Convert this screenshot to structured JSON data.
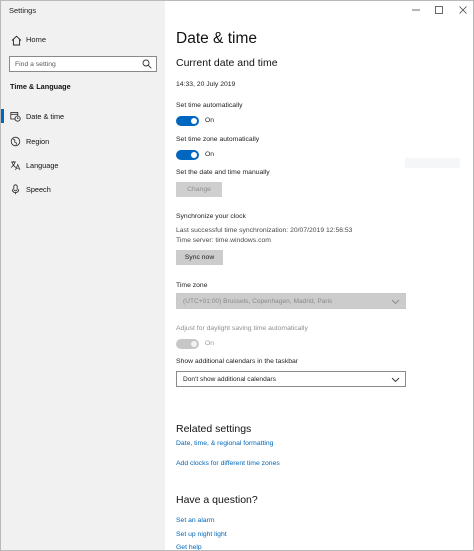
{
  "window": {
    "title": "Settings",
    "controls": {
      "minimize": "—",
      "maximize": "☐",
      "close": "✕"
    }
  },
  "sidebar": {
    "home_label": "Home",
    "search_placeholder": "Find a setting",
    "section_title": "Time & Language",
    "items": [
      {
        "label": "Date & time",
        "icon": "calendar-clock-icon",
        "active": true
      },
      {
        "label": "Region",
        "icon": "globe-icon",
        "active": false
      },
      {
        "label": "Language",
        "icon": "language-icon",
        "active": false
      },
      {
        "label": "Speech",
        "icon": "microphone-icon",
        "active": false
      }
    ]
  },
  "main": {
    "page_title": "Date & time",
    "current_heading": "Current date and time",
    "current_value": "14:33, 20 July 2019",
    "set_time_auto_label": "Set time automatically",
    "set_time_auto_state": "On",
    "set_tz_auto_label": "Set time zone automatically",
    "set_tz_auto_state": "On",
    "manual_label": "Set the date and time manually",
    "change_button": "Change",
    "sync_heading": "Synchronize your clock",
    "last_sync": "Last successful time synchronization: 20/07/2019 12:56:53",
    "time_server": "Time server: time.windows.com",
    "sync_button": "Sync now",
    "timezone_label": "Time zone",
    "timezone_value": "(UTC+01:00) Brussels, Copenhagen, Madrid, Paris",
    "dst_label": "Adjust for daylight saving time automatically",
    "dst_state": "On",
    "calendars_label": "Show additional calendars in the taskbar",
    "calendars_value": "Don't show additional calendars",
    "related_heading": "Related settings",
    "related_links": [
      "Date, time, & regional formatting",
      "Add clocks for different time zones"
    ],
    "question_heading": "Have a question?",
    "question_links": [
      "Set an alarm",
      "Set up night light",
      "Get help"
    ]
  },
  "colors": {
    "accent": "#0067c0",
    "link": "#0067b8",
    "sidebar_bg": "#f1f1f1",
    "button_bg": "#cccccc"
  }
}
